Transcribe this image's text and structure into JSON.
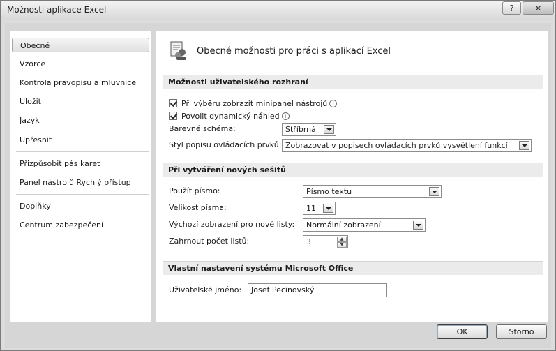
{
  "window": {
    "title": "Možnosti aplikace Excel",
    "help_glyph": "?",
    "close_glyph": "✕"
  },
  "nav": {
    "items": [
      {
        "label": "Obecné",
        "selected": true
      },
      {
        "label": "Vzorce"
      },
      {
        "label": "Kontrola pravopisu a mluvnice"
      },
      {
        "label": "Uložit"
      },
      {
        "label": "Jazyk"
      },
      {
        "label": "Upřesnit"
      },
      {
        "label": "Přizpůsobit pás karet"
      },
      {
        "label": "Panel nástrojů Rychlý přístup"
      },
      {
        "label": "Doplňky"
      },
      {
        "label": "Centrum zabezpečení"
      }
    ]
  },
  "header": {
    "text": "Obecné možnosti pro práci s aplikací Excel",
    "icon": "options-icon"
  },
  "ui_section": {
    "title": "Možnosti uživatelského rozhraní",
    "mini_toolbar_label": "Při výběru zobrazit minipanel nástrojů",
    "mini_toolbar_checked": true,
    "live_preview_label": "Povolit dynamický náhled",
    "live_preview_checked": true,
    "info_glyph": "i",
    "color_scheme_label": "Barevné schéma:",
    "color_scheme_value": "Stříbrná",
    "tooltip_style_label": "Styl popisu ovládacích prvků:",
    "tooltip_style_value": "Zobrazovat v popisech ovládacích prvků vysvětlení funkcí"
  },
  "new_workbook_section": {
    "title": "Při vytváření nových sešitů",
    "font_label": "Použít písmo:",
    "font_value": "Písmo textu",
    "font_size_label": "Velikost písma:",
    "font_size_value": "11",
    "default_view_label": "Výchozí zobrazení pro nové listy:",
    "default_view_value": "Normální zobrazení",
    "sheet_count_label": "Zahrnout počet listů:",
    "sheet_count_value": "3"
  },
  "office_section": {
    "title": "Vlastní nastavení systému Microsoft Office",
    "username_label": "Uživatelské jméno:",
    "username_value": "Josef Pecinovský"
  },
  "buttons": {
    "ok": "OK",
    "cancel": "Storno"
  }
}
